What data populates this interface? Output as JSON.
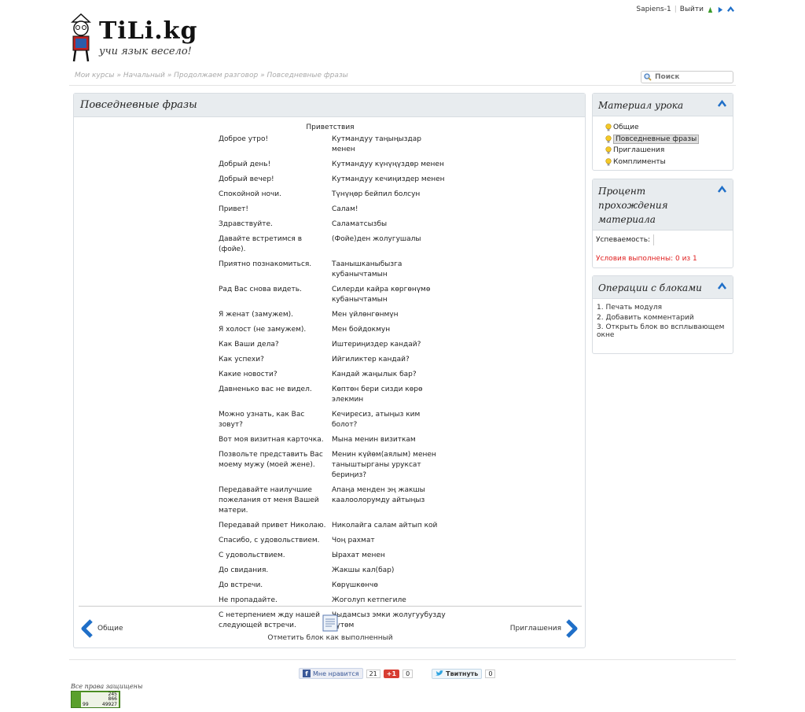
{
  "user": {
    "name": "Sapiens-1",
    "logout": "Выйти"
  },
  "logo": {
    "name": "TiLi.kg",
    "slogan": "учи язык весело!"
  },
  "breadcrumb": [
    "Мои курсы",
    "Начальный",
    "Продолжаем разговор",
    "Повседневные фразы"
  ],
  "breadcrumb_sep": "»",
  "search": {
    "placeholder": "Поиск"
  },
  "main": {
    "title": "Повседневные фразы",
    "section_title": "Приветствия",
    "phrases": [
      {
        "ru": "Доброе утро!",
        "ky": "Кутмандуу таңыңыздар менен"
      },
      {
        "ru": "Добрый день!",
        "ky": "Кутмандуу күнүңүздөр менен"
      },
      {
        "ru": "Добрый вечер!",
        "ky": "Кутмандуу кечиңиздер менен"
      },
      {
        "ru": "Спокойной ночи.",
        "ky": "Түнүңөр бейпил болсун"
      },
      {
        "ru": "Привет!",
        "ky": "Салам!"
      },
      {
        "ru": "Здравствуйте.",
        "ky": "Саламатсызбы"
      },
      {
        "ru": "Давайте встретимся в (фойе).",
        "ky": "(Фойе)ден жолугушалы"
      },
      {
        "ru": "Приятно познакомиться.",
        "ky": "Таанышканыбызга кубанычтамын"
      },
      {
        "ru": "Рад Вас снова видеть.",
        "ky": "Силерди кайра көргөнүмө кубанычтамын"
      },
      {
        "ru": "Я женат (замужем).",
        "ky": "Мен үйлөнгөнмүн"
      },
      {
        "ru": "Я холост (не замужем).",
        "ky": "Мен бойдокмун"
      },
      {
        "ru": "Как Ваши дела?",
        "ky": "Иштериңиздер кандай?"
      },
      {
        "ru": "Как успехи?",
        "ky": "Ийгиликтер кандай?"
      },
      {
        "ru": "Какие новости?",
        "ky": "Кандай жаңылык бар?"
      },
      {
        "ru": "Давненько вас не видел.",
        "ky": "Көптөн бери сизди көрө элекмин"
      },
      {
        "ru": "Можно узнать, как Вас зовут?",
        "ky": "Кечиресиз, атыңыз ким болот?"
      },
      {
        "ru": "Вот моя визитная карточка.",
        "ky": "Мына менин визиткам"
      },
      {
        "ru": "Позвольте представить Вас моему мужу (моей жене).",
        "ky": "Менин күйөм(аялым) менен таныштырганы уруксат бериңиз?"
      },
      {
        "ru": "Передавайте наилучшие пожелания от меня Вашей матери.",
        "ky": "Апаңа менден эң жакшы каалоолорумду айтыңыз"
      },
      {
        "ru": "Передавай привет Николаю.",
        "ky": "Николайга салам айтып кой"
      },
      {
        "ru": "Спасибо, с удовольствием.",
        "ky": "Чоң рахмат"
      },
      {
        "ru": "С удовольствием.",
        "ky": "Ырахат менен"
      },
      {
        "ru": "До свидания.",
        "ky": "Жакшы кал(бар)"
      },
      {
        "ru": "До встречи.",
        "ky": "Көрүшкөнчө"
      },
      {
        "ru": "Не пропадайте.",
        "ky": "Жоголуп кетпегиле"
      },
      {
        "ru": "С нетерпением жду нашей следующей встречи.",
        "ky": "Чыдамсыз эмки жолугуубузду күтөм"
      }
    ],
    "prev_label": "Общие",
    "next_label": "Приглашения",
    "mark_done_label": "Отметить блок как выполненный"
  },
  "sidebar": {
    "material": {
      "title": "Материал урока",
      "items": [
        "Общие",
        "Повседневные фразы",
        "Приглашения",
        "Комплименты"
      ],
      "active_index": 1
    },
    "progress": {
      "title": "Процент прохождения материала",
      "label": "Успеваемость:",
      "value_percent": 0,
      "conditions": "Условия выполнены: 0 из 1"
    },
    "operations": {
      "title": "Операции с блоками",
      "items": [
        "1. Печать модуля",
        "2. Добавить комментарий",
        "3. Открыть блок во всплывающем окне"
      ]
    }
  },
  "footer": {
    "fb_label": "Мне нравится",
    "fb_count": "21",
    "gplus_label": "+1",
    "gplus_count": "0",
    "tw_label": "Твитнуть",
    "tw_count": "0",
    "rights": "Все права защищены",
    "counter": {
      "rows": [
        [
          "",
          "245"
        ],
        [
          "",
          "866"
        ],
        [
          "99",
          "49927"
        ]
      ]
    }
  },
  "colors": {
    "accent_blue": "#1f6fc8",
    "bar_bg": "#e8ecef",
    "warn": "#e02020",
    "counter_green": "#5aa02c"
  }
}
